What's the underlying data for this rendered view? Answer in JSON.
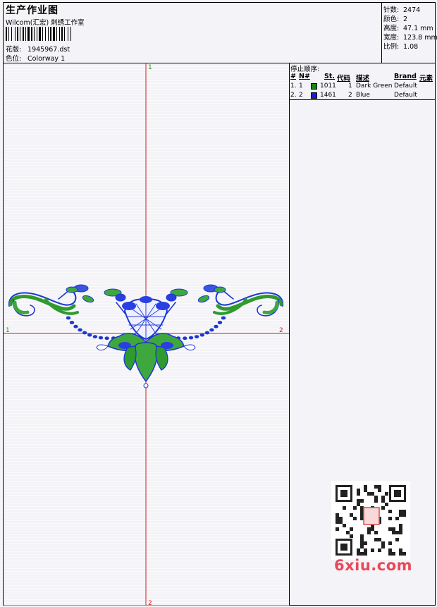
{
  "header": {
    "title": "生产作业图",
    "company": "Wilcom(汇宏) 刺绣工作室",
    "design_label": "花版:",
    "design_value": "1945967.dst",
    "colorway_label": "色位:",
    "colorway_value": "Colorway 1"
  },
  "stats": [
    {
      "label": "针数:",
      "value": "2474"
    },
    {
      "label": "颜色:",
      "value": "2"
    },
    {
      "label": "高度:",
      "value": "47.1 mm"
    },
    {
      "label": "宽度:",
      "value": "123.8 mm"
    },
    {
      "label": "比例:",
      "value": "1.08"
    }
  ],
  "stop_sequence": {
    "title": "停止顺序:",
    "columns": [
      "#",
      "N#",
      "St.",
      "代码",
      "描述",
      "Brand",
      "元素"
    ],
    "rows": [
      {
        "num": "1.",
        "n": "1",
        "color": "#118a1a",
        "stitches": "1011",
        "code": "1",
        "description": "Dark Green",
        "brand": "Default"
      },
      {
        "num": "2.",
        "n": "2",
        "color": "#1a1ae6",
        "stitches": "1461",
        "code": "2",
        "description": "Blue",
        "brand": "Default"
      }
    ]
  },
  "axes": {
    "top_label": "1",
    "bottom_label": "2",
    "left_label": "1",
    "right_label": "2"
  },
  "watermark": {
    "text": "6xiu.com",
    "seal": "以德服人"
  }
}
